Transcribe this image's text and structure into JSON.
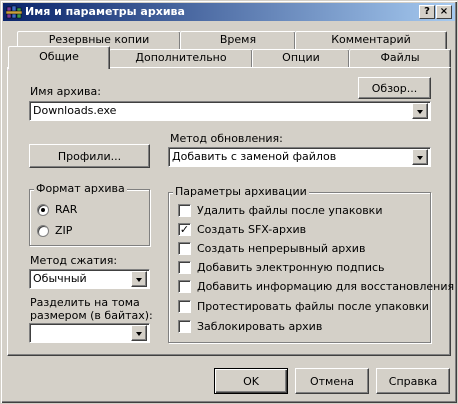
{
  "window": {
    "title": "Имя и параметры архива",
    "help_button": "?",
    "close_button": "×"
  },
  "tabs_back": [
    "Резервные копии",
    "Время",
    "Комментарий"
  ],
  "tabs_front": [
    "Общие",
    "Дополнительно",
    "Опции",
    "Файлы"
  ],
  "general": {
    "archive_name_label": "Имя архива:",
    "browse_label": "Обзор...",
    "archive_name_value": "Downloads.exe",
    "update_method_label": "Метод обновления:",
    "update_method_value": "Добавить с заменой файлов",
    "profiles_label": "Профили...",
    "archive_format": {
      "title": "Формат архива",
      "options": [
        "RAR",
        "ZIP"
      ],
      "selected": "RAR"
    },
    "compression_label": "Метод сжатия:",
    "compression_value": "Обычный",
    "split_label_line1": "Разделить на тома",
    "split_label_line2": "размером (в байтах):",
    "split_value": "",
    "archive_params": {
      "title": "Параметры архивации",
      "options": [
        {
          "label": "Удалить файлы после упаковки",
          "checked": false
        },
        {
          "label": "Создать SFX-архив",
          "checked": true
        },
        {
          "label": "Создать непрерывный архив",
          "checked": false
        },
        {
          "label": "Добавить электронную подпись",
          "checked": false
        },
        {
          "label": "Добавить информацию для восстановления",
          "checked": false
        },
        {
          "label": "Протестировать файлы после упаковки",
          "checked": false
        },
        {
          "label": "Заблокировать архив",
          "checked": false
        }
      ]
    }
  },
  "footer": {
    "ok_label": "OK",
    "cancel_label": "Отмена",
    "help_label": "Справка"
  }
}
